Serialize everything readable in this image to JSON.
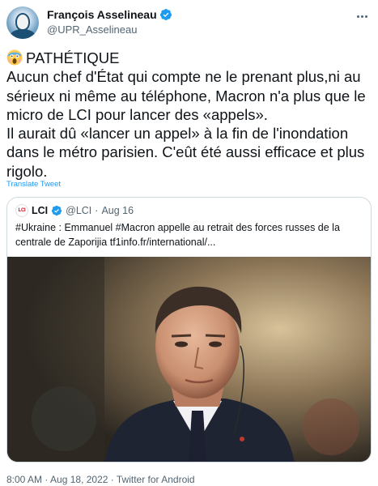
{
  "author": {
    "display_name": "François Asselineau",
    "handle": "@UPR_Asselineau"
  },
  "tweet": {
    "emoji": "screaming-face-emoji",
    "lines": [
      "PATHÉTIQUE",
      "Aucun chef d'État qui compte ne le prenant plus,ni au",
      "sérieux ni même au téléphone, Macron n'a plus que le",
      "micro de LCI pour lancer des «appels».",
      "Il aurait dû «lancer un appel» à la fin de l'inondation",
      "dans le métro parisien. C'eût été aussi efficace et plus",
      "rigolo."
    ],
    "translate_label": "Translate Tweet"
  },
  "quoted": {
    "logo_text": "LCI",
    "name": "LCI",
    "handle": "@LCI",
    "separator": "·",
    "date": "Aug 16",
    "lines": [
      "#Ukraine : Emmanuel #Macron appelle au retrait des forces russes de la",
      "centrale de Zaporijia tf1info.fr/international/..."
    ]
  },
  "meta": {
    "timestamp": "8:00 AM · Aug 18, 2022 · Twitter for Android"
  },
  "colors": {
    "accent": "#1d9bf0",
    "text": "#0f1419",
    "secondary": "#536471",
    "border": "#cfd9de"
  }
}
